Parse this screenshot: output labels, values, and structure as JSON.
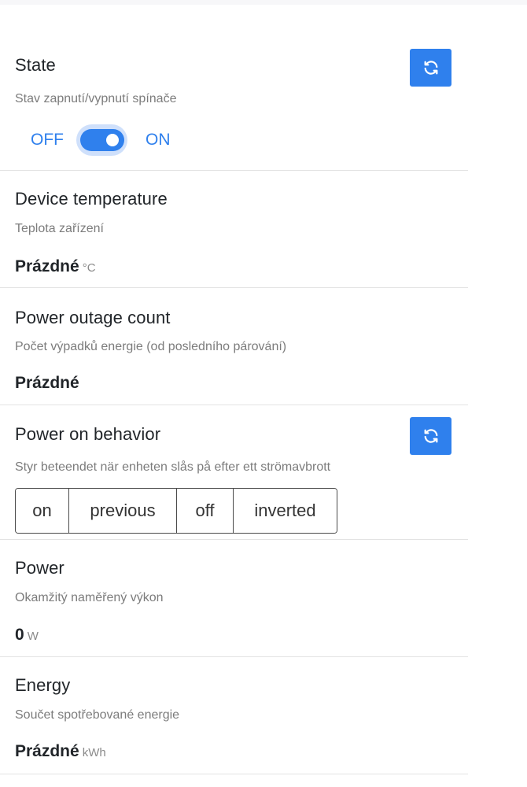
{
  "features": {
    "state": {
      "title": "State",
      "description": "Stav zapnutí/vypnutí spínače",
      "off_label": "OFF",
      "on_label": "ON",
      "toggle_on": true
    },
    "device_temperature": {
      "title": "Device temperature",
      "description": "Teplota zařízení",
      "value": "Prázdné",
      "unit": "°C"
    },
    "power_outage_count": {
      "title": "Power outage count",
      "description": "Počet výpadků energie (od posledního párování)",
      "value": "Prázdné"
    },
    "power_on_behavior": {
      "title": "Power on behavior",
      "description": "Styr beteendet när enheten slås på efter ett strömavbrott",
      "options": [
        "on",
        "previous",
        "off",
        "inverted"
      ]
    },
    "power": {
      "title": "Power",
      "description": "Okamžitý naměřený výkon",
      "value": "0",
      "unit": "W"
    },
    "energy": {
      "title": "Energy",
      "description": "Součet spotřebované energie",
      "value": "Prázdné",
      "unit": "kWh"
    }
  },
  "icons": {
    "refresh": "refresh-icon"
  },
  "colors": {
    "accent": "#2f80ed",
    "switch_halo": "#cfe0fb",
    "title_text": "#212529",
    "muted_text": "#7c7c7c",
    "divider": "#e3e3e3"
  }
}
